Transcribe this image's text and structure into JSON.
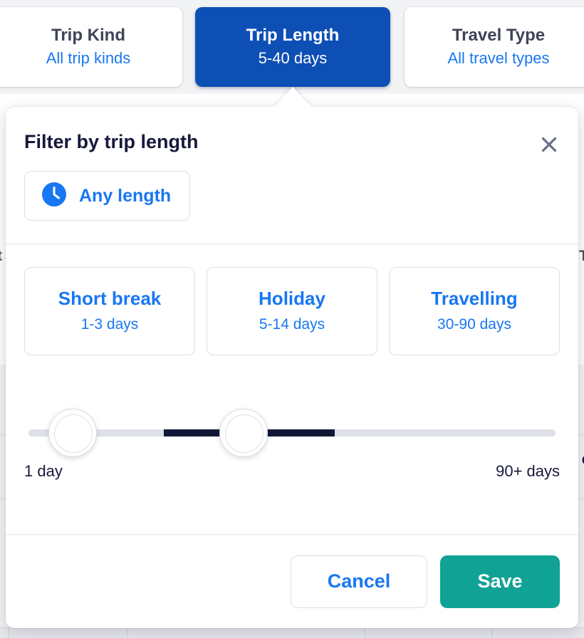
{
  "colors": {
    "accent_blue": "#1877f2",
    "tab_active_blue": "#0d4fb5",
    "save_teal": "#0fa295",
    "dark_navy": "#17183b",
    "track_active": "#0f1836",
    "track_inactive": "#dfe1e8",
    "border_gray": "#dcdee4",
    "page_bg": "#f2f3f5"
  },
  "filter_tabs": [
    {
      "title": "Trip Kind",
      "value": "All trip kinds",
      "active": false
    },
    {
      "title": "Trip Length",
      "value": "5-40 days",
      "active": true
    },
    {
      "title": "Travel Type",
      "value": "All travel types",
      "active": false
    }
  ],
  "background": {
    "left_fragment": "t",
    "right_fragment": "T",
    "right_edge_fragment": "e"
  },
  "dialog": {
    "title": "Filter by trip length",
    "close_icon": "close-icon",
    "any_length": {
      "icon": "clock-icon",
      "label": "Any length"
    },
    "presets": [
      {
        "title": "Short break",
        "range": "1-3 days"
      },
      {
        "title": "Holiday",
        "range": "5-14 days"
      },
      {
        "title": "Travelling",
        "range": "30-90 days"
      }
    ],
    "slider": {
      "min_label": "1 day",
      "max_label": "90+ days",
      "min_value": 5,
      "max_value": 40,
      "range_min": 1,
      "range_max": 90
    },
    "footer": {
      "cancel_label": "Cancel",
      "save_label": "Save"
    }
  }
}
